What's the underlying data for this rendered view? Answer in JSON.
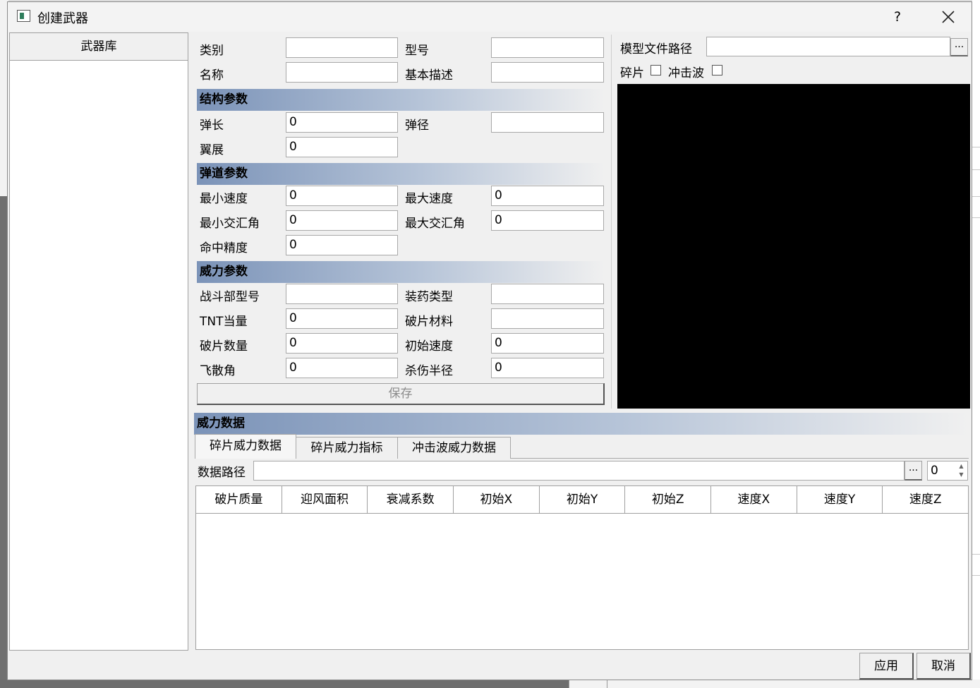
{
  "window": {
    "title": "创建武器",
    "help_label": "?"
  },
  "library": {
    "header": "武器库"
  },
  "basic": {
    "category": {
      "label": "类别",
      "value": ""
    },
    "model": {
      "label": "型号",
      "value": ""
    },
    "name": {
      "label": "名称",
      "value": ""
    },
    "description": {
      "label": "基本描述",
      "value": ""
    }
  },
  "structure": {
    "title": "结构参数",
    "length": {
      "label": "弹长",
      "value": "0"
    },
    "diameter": {
      "label": "弹径",
      "value": ""
    },
    "wingspan": {
      "label": "翼展",
      "value": "0"
    }
  },
  "ballistic": {
    "title": "弹道参数",
    "min_speed": {
      "label": "最小速度",
      "value": "0"
    },
    "max_speed": {
      "label": "最大速度",
      "value": "0"
    },
    "min_angle": {
      "label": "最小交汇角",
      "value": "0"
    },
    "max_angle": {
      "label": "最大交汇角",
      "value": "0"
    },
    "accuracy": {
      "label": "命中精度",
      "value": "0"
    }
  },
  "power": {
    "title": "威力参数",
    "warhead": {
      "label": "战斗部型号",
      "value": ""
    },
    "charge_type": {
      "label": "装药类型",
      "value": ""
    },
    "tnt": {
      "label": "TNT当量",
      "value": "0"
    },
    "frag_material": {
      "label": "破片材料",
      "value": ""
    },
    "frag_count": {
      "label": "破片数量",
      "value": "0"
    },
    "init_speed": {
      "label": "初始速度",
      "value": "0"
    },
    "spread_angle": {
      "label": "飞散角",
      "value": "0"
    },
    "kill_radius": {
      "label": "杀伤半径",
      "value": "0"
    }
  },
  "save_label": "保存",
  "model_file": {
    "label": "模型文件路径",
    "value": "",
    "browse_label": "...",
    "fragment_label": "碎片",
    "shockwave_label": "冲击波"
  },
  "power_data": {
    "title": "威力数据",
    "tabs": [
      "碎片威力数据",
      "碎片威力指标",
      "冲击波威力数据"
    ],
    "path_label": "数据路径",
    "path_value": "",
    "browse_label": "...",
    "spin_value": "0",
    "columns": [
      "破片质量",
      "迎风面积",
      "衰减系数",
      "初始X",
      "初始Y",
      "初始Z",
      "速度X",
      "速度Y",
      "速度Z"
    ]
  },
  "buttons": {
    "apply": "应用",
    "cancel": "取消"
  }
}
